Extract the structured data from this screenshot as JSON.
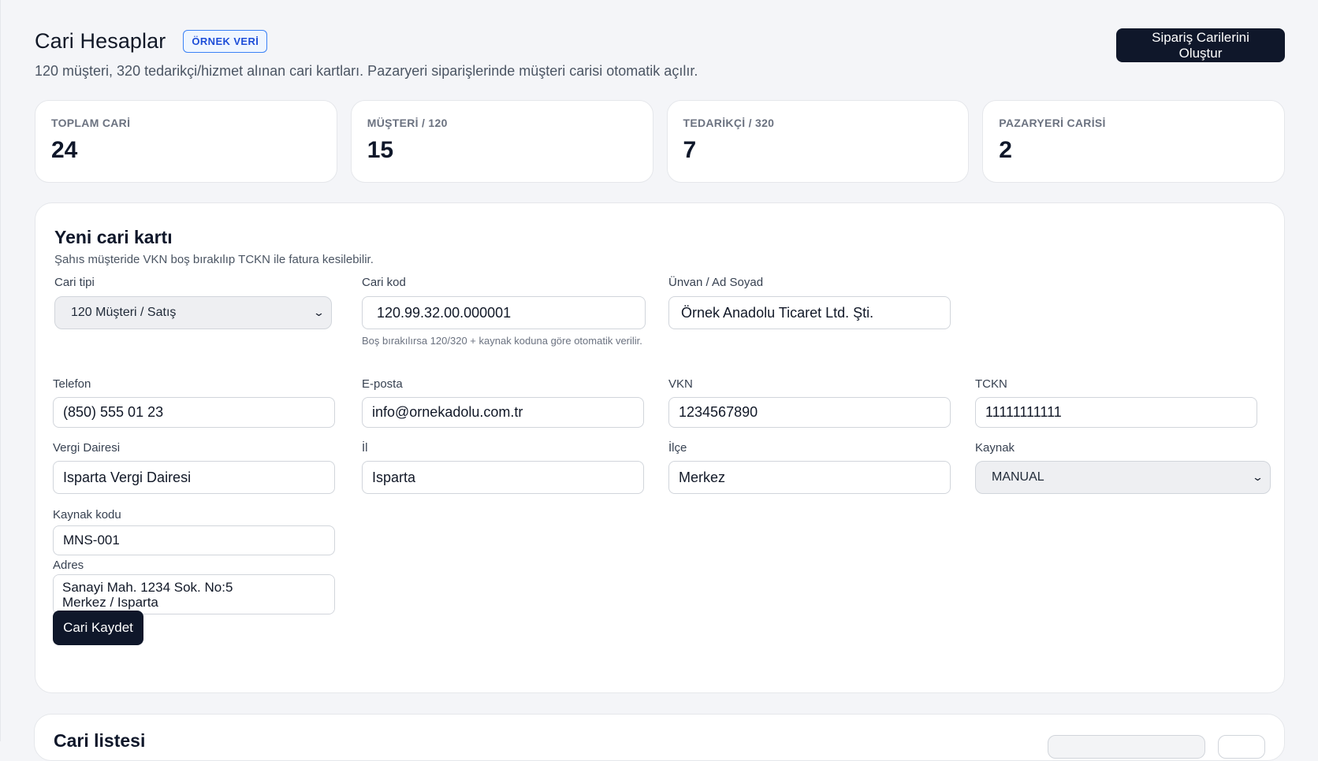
{
  "header": {
    "title": "Cari Hesaplar",
    "badge": "ÖRNEK VERİ",
    "subtitle": "120 müşteri, 320 tedarikçi/hizmet alınan cari kartları. Pazaryeri siparişlerinde müşteri carisi otomatik açılır.",
    "primary_action": "Sipariş Carilerini Oluştur"
  },
  "stats": [
    {
      "label": "TOPLAM CARİ",
      "value": "24"
    },
    {
      "label": "MÜŞTERİ / 120",
      "value": "15"
    },
    {
      "label": "TEDARİKÇİ / 320",
      "value": "7"
    },
    {
      "label": "PAZARYERİ CARİSİ",
      "value": "2"
    }
  ],
  "form": {
    "title": "Yeni cari kartı",
    "hint": "Şahıs müşteride VKN boş bırakılıp TCKN ile fatura kesilebilir.",
    "cari_tipi": {
      "label": "Cari tipi",
      "value": "120 Müşteri / Satış"
    },
    "cari_kod": {
      "label": "Cari kod",
      "value": "120.99.32.00.000001",
      "help": "Boş bırakılırsa 120/320 + kaynak koduna göre otomatik verilir."
    },
    "unvan": {
      "label": "Ünvan / Ad Soyad",
      "value": "Örnek Anadolu Ticaret Ltd. Şti."
    },
    "telefon": {
      "label": "Telefon",
      "value": "(850) 555 01 23"
    },
    "eposta": {
      "label": "E-posta",
      "value": "info@ornekadolu.com.tr"
    },
    "vkn": {
      "label": "VKN",
      "value": "1234567890"
    },
    "tckn": {
      "label": "TCKN",
      "value": "11111111111"
    },
    "vergi_dairesi": {
      "label": "Vergi Dairesi",
      "value": "Isparta Vergi Dairesi"
    },
    "il": {
      "label": "İl",
      "value": "Isparta"
    },
    "ilce": {
      "label": "İlçe",
      "value": "Merkez"
    },
    "kaynak": {
      "label": "Kaynak",
      "value": "MANUAL"
    },
    "kaynak_kodu": {
      "label": "Kaynak kodu",
      "value": "MNS-001"
    },
    "adres": {
      "label": "Adres",
      "value": "Sanayi Mah. 1234 Sok. No:5\nMerkez / Isparta"
    },
    "save_label": "Cari Kaydet"
  },
  "list": {
    "title": "Cari listesi"
  }
}
